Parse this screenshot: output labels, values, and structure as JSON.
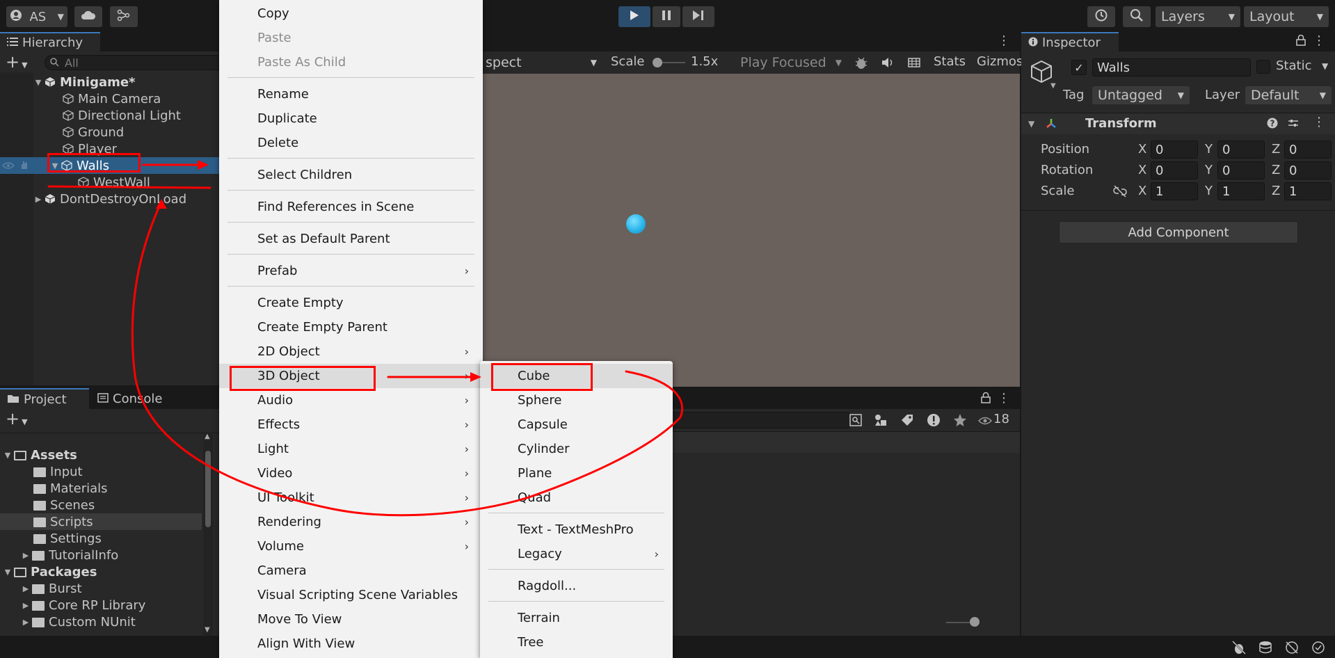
{
  "toolbar": {
    "account_label": "AS",
    "layers_label": "Layers",
    "layout_label": "Layout"
  },
  "hierarchy": {
    "tab_label": "Hierarchy",
    "search_placeholder": "All",
    "items": [
      {
        "label": "Minigame*"
      },
      {
        "label": "Main Camera"
      },
      {
        "label": "Directional Light"
      },
      {
        "label": "Ground"
      },
      {
        "label": "Player"
      },
      {
        "label": "Walls"
      },
      {
        "label": "WestWall"
      },
      {
        "label": "DontDestroyOnLoad"
      }
    ]
  },
  "scene": {
    "aspect_label": "spect",
    "scale_label": "Scale",
    "scale_value": "1.5x",
    "play_focused_label": "Play Focused",
    "stats_label": "Stats",
    "gizmos_label": "Gizmos"
  },
  "project": {
    "tab_project": "Project",
    "tab_console": "Console",
    "visible_count": "18",
    "tree": [
      {
        "label": "Assets"
      },
      {
        "label": "Input"
      },
      {
        "label": "Materials"
      },
      {
        "label": "Scenes"
      },
      {
        "label": "Scripts"
      },
      {
        "label": "Settings"
      },
      {
        "label": "TutorialInfo"
      },
      {
        "label": "Packages"
      },
      {
        "label": "Burst"
      },
      {
        "label": "Core RP Library"
      },
      {
        "label": "Custom NUnit"
      }
    ]
  },
  "inspector": {
    "tab_label": "Inspector",
    "object_name": "Walls",
    "static_label": "Static",
    "tag_label": "Tag",
    "tag_value": "Untagged",
    "layer_label": "Layer",
    "layer_value": "Default",
    "transform_label": "Transform",
    "position_label": "Position",
    "rotation_label": "Rotation",
    "scale_label": "Scale",
    "axis_x": "X",
    "axis_y": "Y",
    "axis_z": "Z",
    "position": [
      "0",
      "0",
      "0"
    ],
    "rotation": [
      "0",
      "0",
      "0"
    ],
    "scale": [
      "1",
      "1",
      "1"
    ],
    "add_component_label": "Add Component"
  },
  "context_menu": {
    "items": [
      {
        "label": "Copy"
      },
      {
        "label": "Paste"
      },
      {
        "label": "Paste As Child"
      },
      {
        "label": "Rename"
      },
      {
        "label": "Duplicate"
      },
      {
        "label": "Delete"
      },
      {
        "label": "Select Children"
      },
      {
        "label": "Find References in Scene"
      },
      {
        "label": "Set as Default Parent"
      },
      {
        "label": "Prefab"
      },
      {
        "label": "Create Empty"
      },
      {
        "label": "Create Empty Parent"
      },
      {
        "label": "2D Object"
      },
      {
        "label": "3D Object"
      },
      {
        "label": "Audio"
      },
      {
        "label": "Effects"
      },
      {
        "label": "Light"
      },
      {
        "label": "Video"
      },
      {
        "label": "UI Toolkit"
      },
      {
        "label": "Rendering"
      },
      {
        "label": "Volume"
      },
      {
        "label": "Camera"
      },
      {
        "label": "Visual Scripting Scene Variables"
      },
      {
        "label": "Move To View"
      },
      {
        "label": "Align With View"
      }
    ]
  },
  "submenu": {
    "items": [
      {
        "label": "Cube"
      },
      {
        "label": "Sphere"
      },
      {
        "label": "Capsule"
      },
      {
        "label": "Cylinder"
      },
      {
        "label": "Plane"
      },
      {
        "label": "Quad"
      },
      {
        "label": "Text - TextMeshPro"
      },
      {
        "label": "Legacy"
      },
      {
        "label": "Ragdoll..."
      },
      {
        "label": "Terrain"
      },
      {
        "label": "Tree"
      }
    ]
  },
  "icons": {
    "account": "account-icon",
    "cloud": "cloud-icon",
    "collab": "collab-icon",
    "play": "play-icon",
    "pause": "pause-icon",
    "step": "step-icon",
    "history": "history-icon",
    "search": "search-icon",
    "gameobject": "cube-icon",
    "lock": "lock-icon",
    "kebab": "kebab-icon"
  },
  "colors": {
    "selection": "#2c5d87",
    "play_active": "#2b4d6e",
    "annotation": "#ff0000",
    "sphere": "#29b6ea",
    "menu_bg": "#f2f2f2",
    "scene_bg": "#6a605c"
  }
}
